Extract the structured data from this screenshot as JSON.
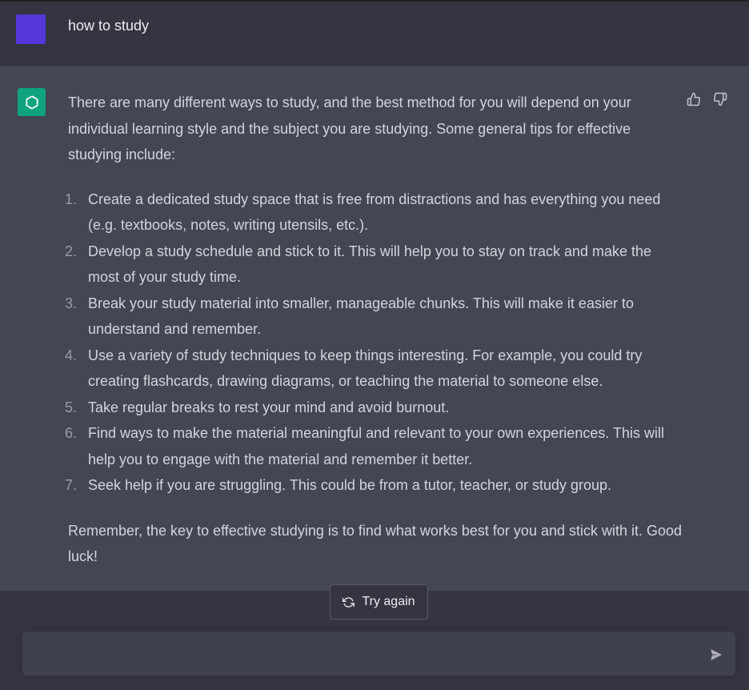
{
  "conversation": {
    "user_message": "how to study",
    "assistant": {
      "intro": "There are many different ways to study, and the best method for you will depend on your individual learning style and the subject you are studying. Some general tips for effective studying include:",
      "tips": [
        {
          "num": "1.",
          "text": "Create a dedicated study space that is free from distractions and has everything you need (e.g. textbooks, notes, writing utensils, etc.)."
        },
        {
          "num": "2.",
          "text": "Develop a study schedule and stick to it. This will help you to stay on track and make the most of your study time."
        },
        {
          "num": "3.",
          "text": "Break your study material into smaller, manageable chunks. This will make it easier to understand and remember."
        },
        {
          "num": "4.",
          "text": "Use a variety of study techniques to keep things interesting. For example, you could try creating flashcards, drawing diagrams, or teaching the material to someone else."
        },
        {
          "num": "5.",
          "text": "Take regular breaks to rest your mind and avoid burnout."
        },
        {
          "num": "6.",
          "text": "Find ways to make the material meaningful and relevant to your own experiences. This will help you to engage with the material and remember it better."
        },
        {
          "num": "7.",
          "text": "Seek help if you are struggling. This could be from a tutor, teacher, or study group."
        }
      ],
      "outro": "Remember, the key to effective studying is to find what works best for you and stick with it. Good luck!"
    }
  },
  "actions": {
    "try_again_label": "Try again"
  },
  "composer": {
    "value": "",
    "placeholder": ""
  },
  "icons": {
    "user_avatar": "user-avatar",
    "assistant_avatar": "openai-logo-icon",
    "thumbs_up": "thumbs-up-icon",
    "thumbs_down": "thumbs-down-icon",
    "regenerate": "refresh-icon",
    "send": "send-icon"
  },
  "colors": {
    "background": "#343541",
    "assistant_background": "#444654",
    "user_avatar": "#5436da",
    "assistant_avatar": "#10a37f",
    "composer_background": "#40414f"
  }
}
